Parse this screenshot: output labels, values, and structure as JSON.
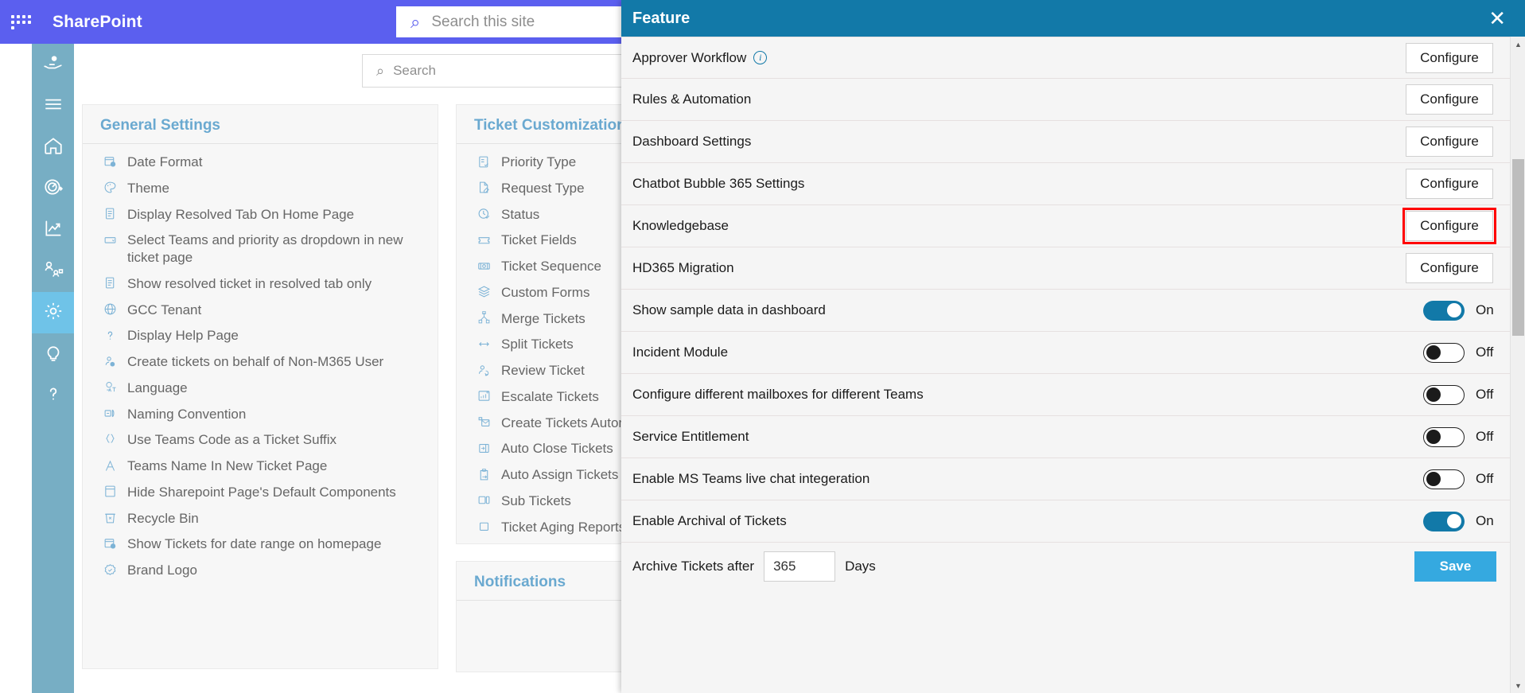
{
  "suitebar": {
    "waffle_icon": "app-launcher-icon",
    "title": "SharePoint",
    "search_placeholder": "Search this site",
    "search_icon": "search-icon"
  },
  "rail": {
    "items": [
      {
        "name": "service-hand-icon",
        "label": "Service"
      },
      {
        "name": "hamburger-menu-icon",
        "label": "Menu"
      },
      {
        "name": "home-icon",
        "label": "Home"
      },
      {
        "name": "dashboard-gauge-icon",
        "label": "Dashboard"
      },
      {
        "name": "analytics-chart-icon",
        "label": "Reports"
      },
      {
        "name": "teams-org-icon",
        "label": "Teams"
      },
      {
        "name": "gear-icon",
        "label": "Settings",
        "active": true
      },
      {
        "name": "lightbulb-icon",
        "label": "Ideas"
      },
      {
        "name": "question-mark-icon",
        "label": "Help"
      }
    ]
  },
  "content_search": {
    "placeholder": "Search",
    "value": "",
    "icon": "search-icon"
  },
  "panels": {
    "general": {
      "title": "General Settings",
      "items": [
        {
          "icon": "calendar-clock-icon",
          "label": "Date Format"
        },
        {
          "icon": "palette-icon",
          "label": "Theme"
        },
        {
          "icon": "document-list-icon",
          "label": "Display Resolved Tab On Home Page"
        },
        {
          "icon": "dropdown-icon",
          "label": "Select Teams and priority as dropdown in new ticket page"
        },
        {
          "icon": "document-list-icon",
          "label": "Show resolved ticket in resolved tab only"
        },
        {
          "icon": "globe-icon",
          "label": "GCC Tenant"
        },
        {
          "icon": "question-mark-icon",
          "label": "Display Help Page"
        },
        {
          "icon": "person-block-icon",
          "label": "Create tickets on behalf of Non-M365 User"
        },
        {
          "icon": "language-icon",
          "label": "Language"
        },
        {
          "icon": "naming-convention-icon",
          "label": "Naming Convention"
        },
        {
          "icon": "braces-icon",
          "label": "Use Teams Code as a Ticket Suffix"
        },
        {
          "icon": "letter-a-icon",
          "label": "Teams Name In New Ticket Page"
        },
        {
          "icon": "page-hide-icon",
          "label": "Hide Sharepoint Page's Default Components"
        },
        {
          "icon": "recycle-bin-icon",
          "label": "Recycle Bin"
        },
        {
          "icon": "calendar-clock-icon",
          "label": "Show Tickets for date range on homepage"
        },
        {
          "icon": "badge-check-icon",
          "label": "Brand Logo"
        }
      ]
    },
    "ticket": {
      "title": "Ticket Customizations",
      "items": [
        {
          "icon": "priority-list-icon",
          "label": "Priority Type"
        },
        {
          "icon": "request-edit-icon",
          "label": "Request Type"
        },
        {
          "icon": "clock-check-icon",
          "label": "Status"
        },
        {
          "icon": "ticket-icon",
          "label": "Ticket Fields"
        },
        {
          "icon": "ticket-sequence-icon",
          "label": "Ticket Sequence"
        },
        {
          "icon": "layers-icon",
          "label": "Custom Forms"
        },
        {
          "icon": "merge-icon",
          "label": "Merge Tickets"
        },
        {
          "icon": "split-arrows-icon",
          "label": "Split Tickets"
        },
        {
          "icon": "review-person-icon",
          "label": "Review Ticket"
        },
        {
          "icon": "escalate-chart-icon",
          "label": "Escalate Tickets"
        },
        {
          "icon": "mail-create-icon",
          "label": "Create Tickets Automa"
        },
        {
          "icon": "auto-close-icon",
          "label": "Auto Close Tickets"
        },
        {
          "icon": "clipboard-arrow-icon",
          "label": "Auto Assign Tickets"
        },
        {
          "icon": "sub-tickets-icon",
          "label": "Sub Tickets"
        },
        {
          "icon": "square-icon",
          "label": "Ticket Aging Reports"
        }
      ]
    },
    "notifications": {
      "title": "Notifications",
      "items": []
    }
  },
  "flyout": {
    "title": "Feature",
    "close_icon": "close-icon",
    "configure_label": "Configure",
    "rows": [
      {
        "label": "Approver Workflow",
        "type": "configure",
        "info": true,
        "highlighted": false
      },
      {
        "label": "Rules & Automation",
        "type": "configure",
        "info": false,
        "highlighted": false
      },
      {
        "label": "Dashboard Settings",
        "type": "configure",
        "info": false,
        "highlighted": false
      },
      {
        "label": "Chatbot Bubble 365 Settings",
        "type": "configure",
        "info": false,
        "highlighted": false
      },
      {
        "label": "Knowledgebase",
        "type": "configure",
        "info": false,
        "highlighted": true
      },
      {
        "label": "HD365 Migration",
        "type": "configure",
        "info": false,
        "highlighted": false
      },
      {
        "label": "Show sample data in dashboard",
        "type": "toggle",
        "state": "On"
      },
      {
        "label": "Incident Module",
        "type": "toggle",
        "state": "Off"
      },
      {
        "label": "Configure different mailboxes for different Teams",
        "type": "toggle",
        "state": "Off"
      },
      {
        "label": "Service Entitlement",
        "type": "toggle",
        "state": "Off"
      },
      {
        "label": "Enable MS Teams live chat integeration",
        "type": "toggle",
        "state": "Off"
      },
      {
        "label": "Enable Archival of Tickets",
        "type": "toggle",
        "state": "On"
      }
    ],
    "archive": {
      "prefix_label": "Archive Tickets after",
      "value": "365",
      "suffix_label": "Days",
      "save_label": "Save"
    },
    "highlight_color": "#ff0000",
    "header_color": "#1279a8",
    "accent_color": "#35a9e0"
  }
}
